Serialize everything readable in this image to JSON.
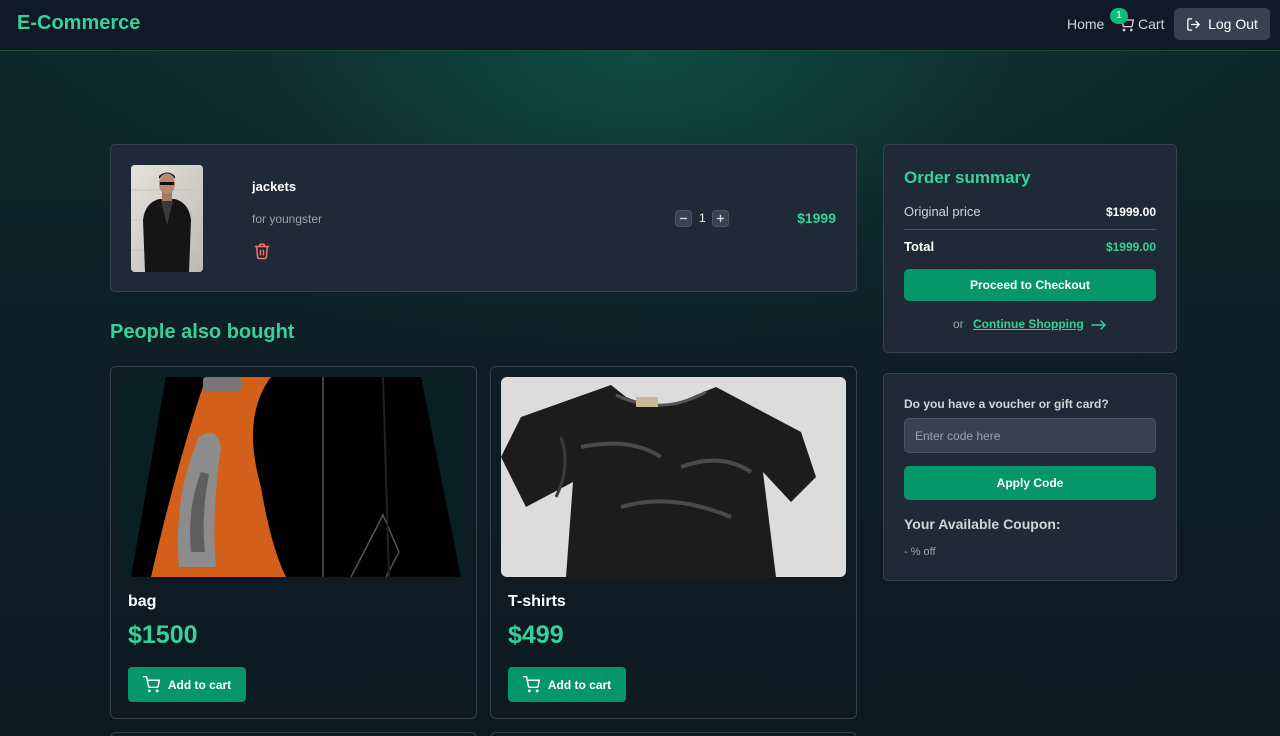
{
  "navbar": {
    "brand": "E-Commerce",
    "home_label": "Home",
    "cart_label": "Cart",
    "cart_count": "1",
    "logout_label": "Log Out"
  },
  "cart": {
    "items": [
      {
        "name": "jackets",
        "description": "for youngster",
        "quantity": "1",
        "price": "$1999"
      }
    ]
  },
  "recommendations": {
    "title": "People also bought",
    "products": [
      {
        "name": "bag",
        "price": "$1500",
        "button_label": "Add to cart"
      },
      {
        "name": "T-shirts",
        "price": "$499",
        "button_label": "Add to cart"
      }
    ]
  },
  "summary": {
    "title": "Order summary",
    "original_price_label": "Original price",
    "original_price_value": "$1999.00",
    "total_label": "Total",
    "total_value": "$1999.00",
    "checkout_label": "Proceed to Checkout",
    "or_text": "or",
    "continue_label": "Continue Shopping"
  },
  "voucher": {
    "label": "Do you have a voucher or gift card?",
    "placeholder": "Enter code here",
    "apply_label": "Apply Code",
    "coupon_title": "Your Available Coupon:",
    "coupon_value": "- % off"
  },
  "colors": {
    "accent": "#34d399",
    "button": "#059669",
    "card_bg": "#1f2937",
    "delete": "#f87171"
  },
  "icons": [
    "cart-icon",
    "logout-icon",
    "trash-icon",
    "minus-icon",
    "plus-icon",
    "arrow-right-icon"
  ]
}
